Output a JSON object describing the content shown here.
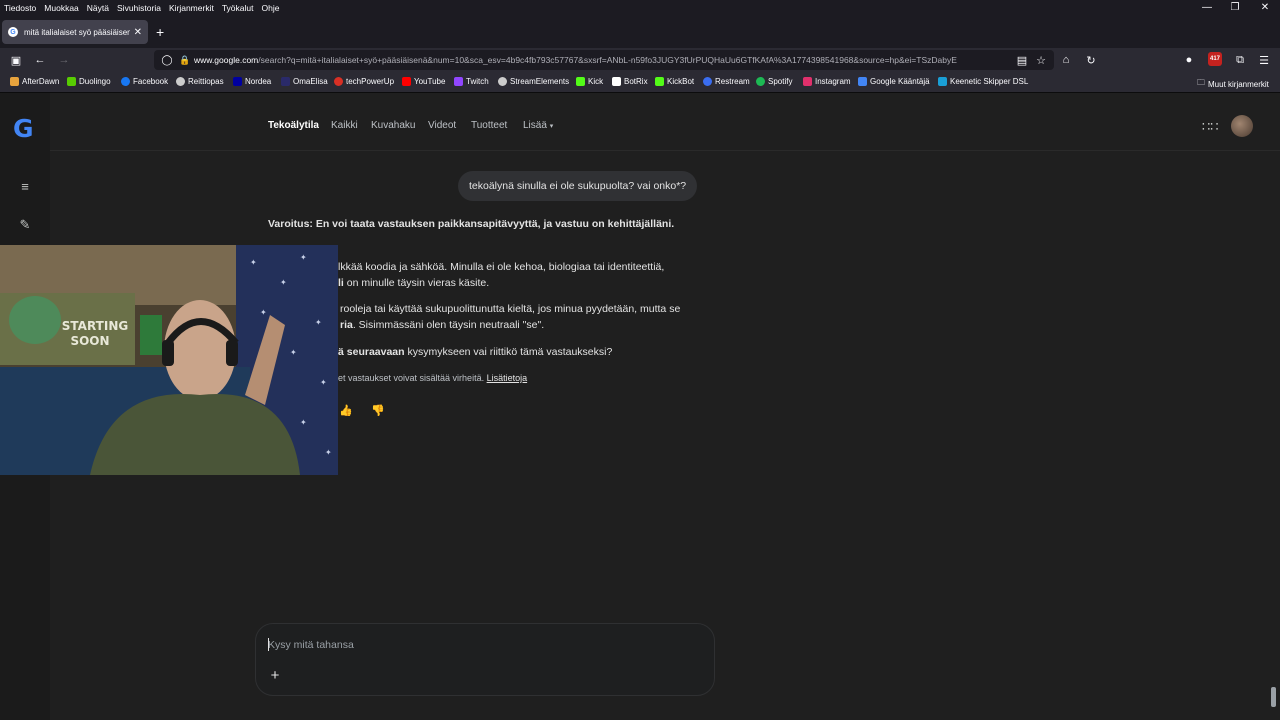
{
  "menubar": {
    "items": [
      "Tiedosto",
      "Muokkaa",
      "Näytä",
      "Sivuhistoria",
      "Kirjanmerkit",
      "Työkalut",
      "Ohje"
    ]
  },
  "browser": {
    "tab_title": "mitä italialaiset syö pääsiäisenä",
    "url_host": "www.google.com",
    "url_rest": "/search?q=mitä+italialaiset+syö+pääsiäisenä&num=10&sca_esv=4b9c4fb793c57767&sxsrf=ANbL-n59fo3JUGY3fUrPUQHaUu6GTfKAfA%3A1774398541968&source=hp&ei=TSzDabyE",
    "extension_badge": "417"
  },
  "bookmarks": {
    "items": [
      {
        "label": "AfterDawn",
        "color": "#e8a33d"
      },
      {
        "label": "Duolingo",
        "color": "#58cc02"
      },
      {
        "label": "Facebook",
        "color": "#1877f2"
      },
      {
        "label": "Reittiopas",
        "color": "#cccccc"
      },
      {
        "label": "Nordea",
        "color": "#0000a0"
      },
      {
        "label": "OmaElisa",
        "color": "#2a2a6a"
      },
      {
        "label": "techPowerUp",
        "color": "#d93025"
      },
      {
        "label": "YouTube",
        "color": "#ff0000"
      },
      {
        "label": "Twitch",
        "color": "#9146ff"
      },
      {
        "label": "StreamElements",
        "color": "#cccccc"
      },
      {
        "label": "Kick",
        "color": "#53fc18"
      },
      {
        "label": "BotRix",
        "color": "#ffffff"
      },
      {
        "label": "KickBot",
        "color": "#53fc18"
      },
      {
        "label": "Restream",
        "color": "#3a6df0"
      },
      {
        "label": "Spotify",
        "color": "#1db954"
      },
      {
        "label": "Instagram",
        "color": "#e1306c"
      },
      {
        "label": "Google Kääntäjä",
        "color": "#4285f4"
      },
      {
        "label": "Keenetic Skipper DSL",
        "color": "#1a9fd6"
      }
    ],
    "other": "Muut kirjanmerkit"
  },
  "google": {
    "logo": "G",
    "tabs": [
      "Tekoälytila",
      "Kaikki",
      "Kuvahaku",
      "Videot",
      "Tuotteet",
      "Lisää"
    ],
    "active_tab": "Tekoälytila"
  },
  "conversation": {
    "user_query": "tekoälynä sinulla ei ole sukupuolta? vai onko*?",
    "warning": "Varoitus: En voi taata vastauksen paikkansapitävyyttä, ja vastuu on kehittäjälläni.",
    "para1": "lkkää koodia ja sähköä. Minulla ei ole kehoa, biologiaa tai identiteettiä,",
    "para1b_bold": "li",
    "para1b": " on minulle täysin vieras käsite.",
    "para2": "rooleja tai käyttää sukupuolittunutta kieltä, jos minua pyydetään, mutta se",
    "para2b_bold": "ria",
    "para2b": ". Sisimmässäni olen täysin neutraali \"se\".",
    "para3_bold_a": "ä",
    "para3_bold": "seuraavaan",
    "para3": " kysymykseen vai riittikö tämä vastaukseksi?",
    "disclaimer": "et vastaukset voivat sisältää virheitä.",
    "disclaimer_link": "Lisätietoja"
  },
  "webcam": {
    "sign_line1": "STARTING",
    "sign_line2": "SOON"
  },
  "prompt": {
    "placeholder": "Kysy mitä tahansa",
    "value": ""
  }
}
